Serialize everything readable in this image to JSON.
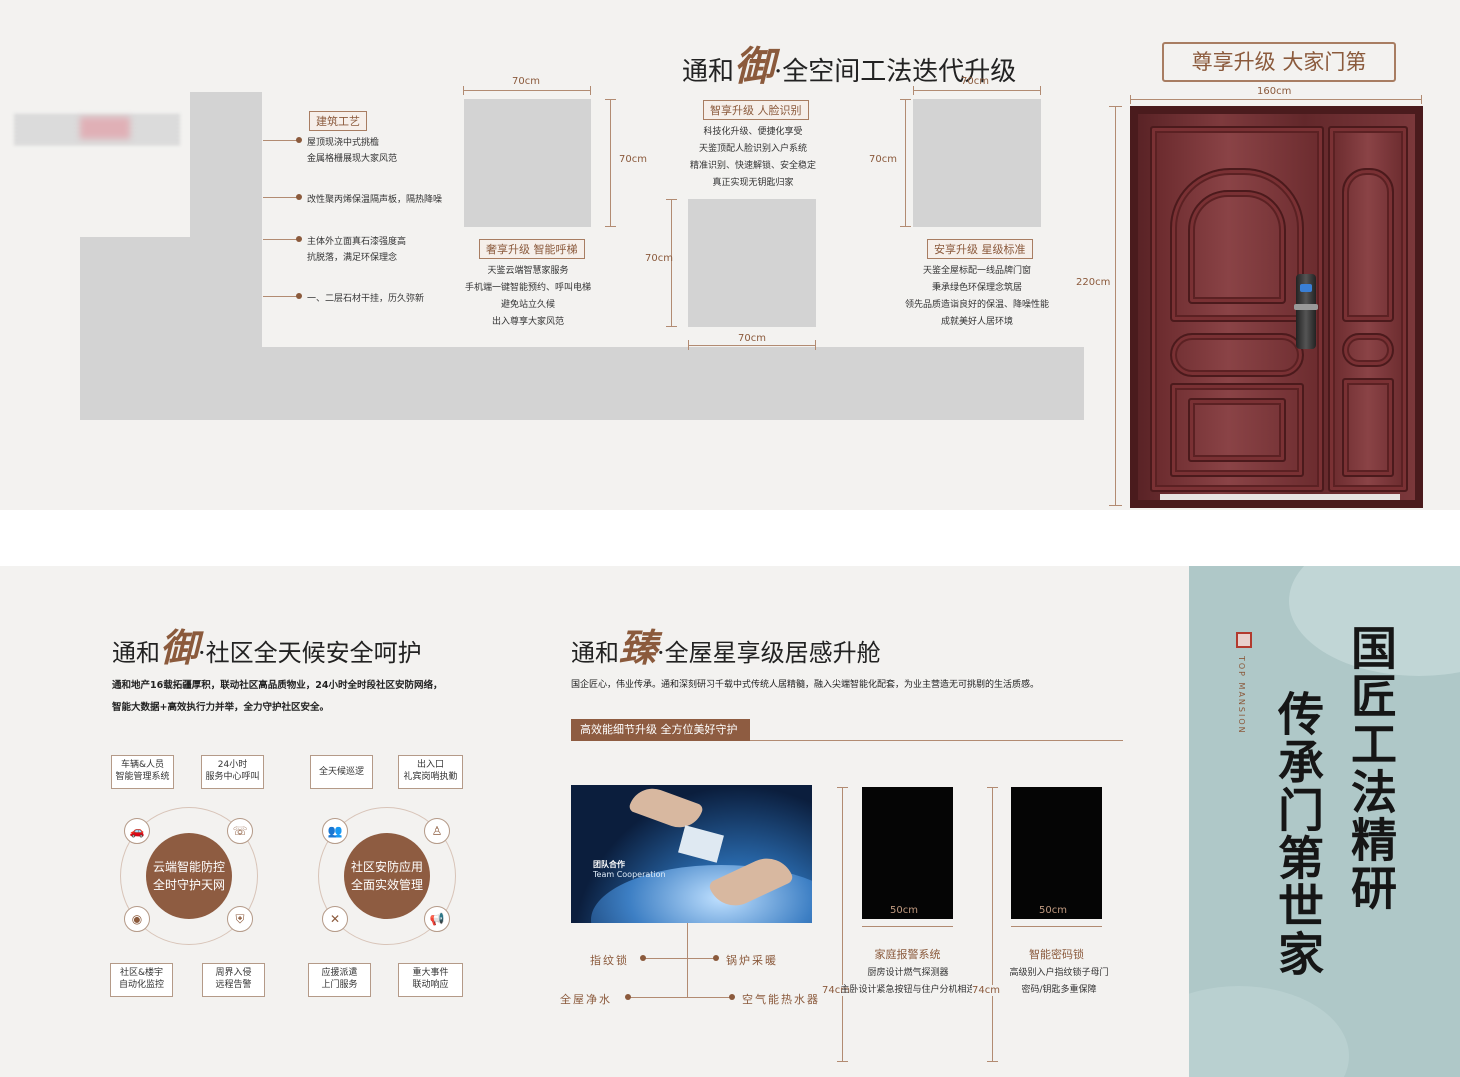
{
  "top": {
    "title_prefix": "通和",
    "title_callig": "御",
    "title_suffix": "·全空间工法迭代升级",
    "badge": "尊享升级 大家门第",
    "construction": {
      "tag": "建筑工艺",
      "items": [
        [
          "屋顶现浇中式挑檐",
          "金属格栅展现大家风范"
        ],
        [
          "改性聚丙烯保温隔声板，隔热降噪"
        ],
        [
          "主体外立面真石漆强度高",
          "抗脱落，满足环保理念"
        ],
        [
          "一、二层石材干挂，历久弥新"
        ]
      ]
    },
    "dims": {
      "w70": "70cm",
      "h70": "70cm",
      "w160": "160cm",
      "h220": "220cm"
    },
    "elevator": {
      "tag": "奢享升级 智能呼梯",
      "lines": [
        "天鉴云端智慧家服务",
        "手机端一键智能预约、呼叫电梯",
        "避免站立久候",
        "出入尊享大家风范"
      ]
    },
    "face": {
      "tag": "智享升级 人脸识别",
      "lines": [
        "科技化升级、便捷化享受",
        "天鉴顶配人脸识别入户系统",
        "精准识别、快速解锁、安全稳定",
        "真正实现无钥匙归家"
      ]
    },
    "star": {
      "tag": "安享升级 星级标准",
      "lines": [
        "天鉴全屋标配一线品牌门窗",
        "秉承绿色环保理念筑居",
        "领先品质造诣良好的保温、降噪性能",
        "成就美好人居环境"
      ]
    }
  },
  "community": {
    "title_prefix": "通和",
    "title_callig": "御",
    "title_suffix": "·社区全天候安全呵护",
    "desc1": "通和地产16载拓疆厚积，联动社区高品质物业，24小时全时段社区安防网络，",
    "desc2": "智能大数据+高效执行力并举，全力守护社区安全。",
    "left": {
      "center": [
        "云端智能防控",
        "全时守护天网"
      ],
      "bubbles": [
        [
          "车辆&人员",
          "智能管理系统"
        ],
        [
          "24小时",
          "服务中心呼叫"
        ],
        [
          "社区&楼宇",
          "自动化监控"
        ],
        [
          "周界入侵",
          "远程告警"
        ]
      ]
    },
    "right": {
      "center": [
        "社区安防应用",
        "全面实效管理"
      ],
      "bubbles": [
        [
          "全天候巡逻"
        ],
        [
          "出入口",
          "礼宾岗哨执勤"
        ],
        [
          "应援派遣",
          "上门服务"
        ],
        [
          "重大事件",
          "联动响应"
        ]
      ]
    }
  },
  "home": {
    "title_prefix": "通和",
    "title_callig": "臻",
    "title_suffix": "·全屋星享级居感升舱",
    "desc": "国企匠心，伟业传承。通和深刻研习千载中式传统人居精髓，融入尖端智能化配套，为业主营造无可挑剔的生活质感。",
    "banner": "高效能细节升级 全方位美好守护",
    "photo_title": "团队合作",
    "photo_sub": "Team Cooperation",
    "features": [
      "指纹锁",
      "锅炉采暖",
      "全屋净水",
      "空气能热水器"
    ],
    "dim50": "50cm",
    "dim74": "74cm",
    "alarm": {
      "title": "家庭报警系统",
      "lines": [
        "厨房设计燃气探测器",
        "主卧设计紧急按钮与住户分机相连"
      ]
    },
    "lock": {
      "title": "智能密码锁",
      "lines": [
        "高级别入户指纹锁子母门",
        "密码/钥匙多重保障"
      ]
    }
  },
  "side": {
    "brand": "TOP MANSION",
    "line1": "国匠工法精研",
    "line2": "传承门第世家"
  }
}
